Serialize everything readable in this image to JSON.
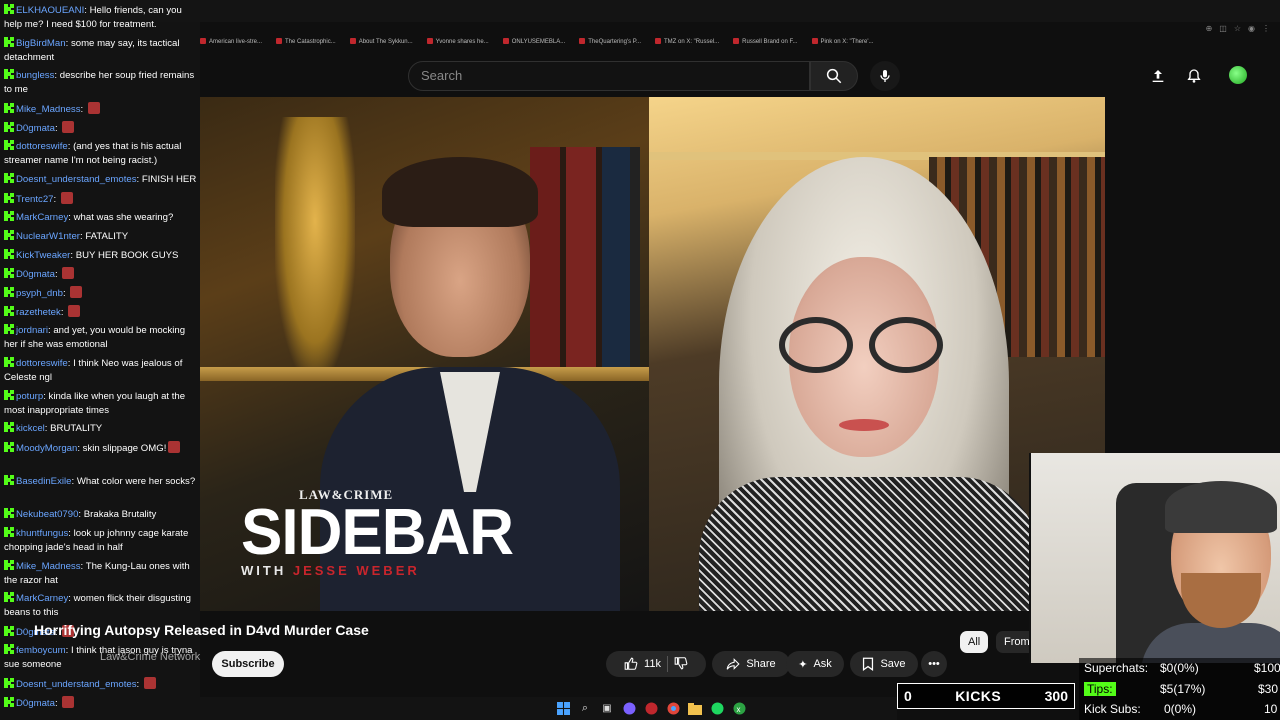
{
  "browser": {
    "bookmarks": [
      "American live-stre...",
      "The Catastrophic...",
      "About The Sykkun...",
      "Yvonne shares he...",
      "ONLYUSEMEBLA...",
      "TheQuartering's P...",
      "TMZ on X: \"Russel...",
      "Russell Brand on F...",
      "Pink on X: \"There'..."
    ]
  },
  "youtube": {
    "search_placeholder": "Search",
    "video_title": "Horrifying Autopsy Released in D4vd Murder Case",
    "channel": "Law&Crime Network",
    "subscribe_label": "Subscribe",
    "like_count": "11k",
    "share_label": "Share",
    "ask_label": "Ask",
    "save_label": "Save",
    "chips": [
      "All",
      "From"
    ]
  },
  "video_overlay": {
    "brand": "LAW&CRIME",
    "show": "SIDEBAR",
    "with": "WITH",
    "host": "JESSE WEBER"
  },
  "chat": [
    {
      "user": "ELKHAOUEANI",
      "text": "Hello friends, can you help me? I need $100 for treatment.",
      "color": "blue"
    },
    {
      "user": "BigBirdMan",
      "text": "some may say, its tactical detachment",
      "color": "blue"
    },
    {
      "user": "bungless",
      "text": "describe her soup fried remains to me",
      "color": "blue"
    },
    {
      "user": "Mike_Madness",
      "text": "",
      "color": "blue",
      "emote": true
    },
    {
      "user": "D0gmata",
      "text": "",
      "color": "blue",
      "emote": true
    },
    {
      "user": "dottoreswife",
      "text": "(and yes that is his actual streamer name I'm not being racist.)",
      "color": "blue"
    },
    {
      "user": "Doesnt_understand_emotes",
      "text": "FINISH HER",
      "color": "blue"
    },
    {
      "user": "Trentc27",
      "text": "",
      "color": "blue",
      "emote": true
    },
    {
      "user": "MarkCarney",
      "text": "what was she wearing?",
      "color": "blue"
    },
    {
      "user": "NuclearW1nter",
      "text": "FATALITY",
      "color": "blue"
    },
    {
      "user": "KickTweaker",
      "text": "BUY HER BOOK GUYS",
      "color": "blue"
    },
    {
      "user": "D0gmata",
      "text": "",
      "color": "blue",
      "emote": true
    },
    {
      "user": "psyph_dnb",
      "text": "",
      "color": "blue",
      "emote": true
    },
    {
      "user": "razethetek",
      "text": "",
      "color": "blue",
      "emote": true
    },
    {
      "user": "jordnari",
      "text": "and yet, you would be mocking her if she was emotional",
      "color": "blue"
    },
    {
      "user": "dottoreswife",
      "text": "I think Neo was jealous of Celeste ngl",
      "color": "blue"
    },
    {
      "user": "poturp",
      "text": "kinda like when you laugh at the most inappropriate times",
      "color": "blue"
    },
    {
      "user": "kickcel",
      "text": "BRUTALITY",
      "color": "blue"
    },
    {
      "user": "MoodyMorgan",
      "text": "skin slippage OMG!",
      "color": "blue",
      "emote": true
    },
    {
      "user": "BasedinExile",
      "text": "What color were her socks?",
      "color": "blue"
    },
    {
      "user": "Nekubeat0790",
      "text": "Brakaka Brutality",
      "color": "blue"
    },
    {
      "user": "khuntfungus",
      "text": "look up johnny cage karate chopping jade's head in half",
      "color": "blue"
    },
    {
      "user": "Mike_Madness",
      "text": "The Kung-Lau ones with the razor hat",
      "color": "blue"
    },
    {
      "user": "MarkCarney",
      "text": "women flick their disgusting beans to this",
      "color": "blue"
    },
    {
      "user": "D0gmata",
      "text": "",
      "color": "blue",
      "emote": true
    },
    {
      "user": "femboycum",
      "text": "I think that jason guy is tryna sue someone",
      "color": "blue"
    },
    {
      "user": "Doesnt_understand_emotes",
      "text": "",
      "color": "blue",
      "emote": true
    },
    {
      "user": "D0gmata",
      "text": "",
      "color": "blue",
      "emote": true
    }
  ],
  "kicks": {
    "left": "0",
    "label": "KICKS",
    "right": "300"
  },
  "stats": {
    "superchats_label": "Superchats:",
    "superchats_value": "$0(0%)",
    "superchats_goal": "$100",
    "tips_label": "Tips:",
    "tips_value": "$5(17%)",
    "tips_goal": "$30",
    "subs_label": "Kick Subs:",
    "subs_value": "0(0%)",
    "subs_goal": "10"
  }
}
